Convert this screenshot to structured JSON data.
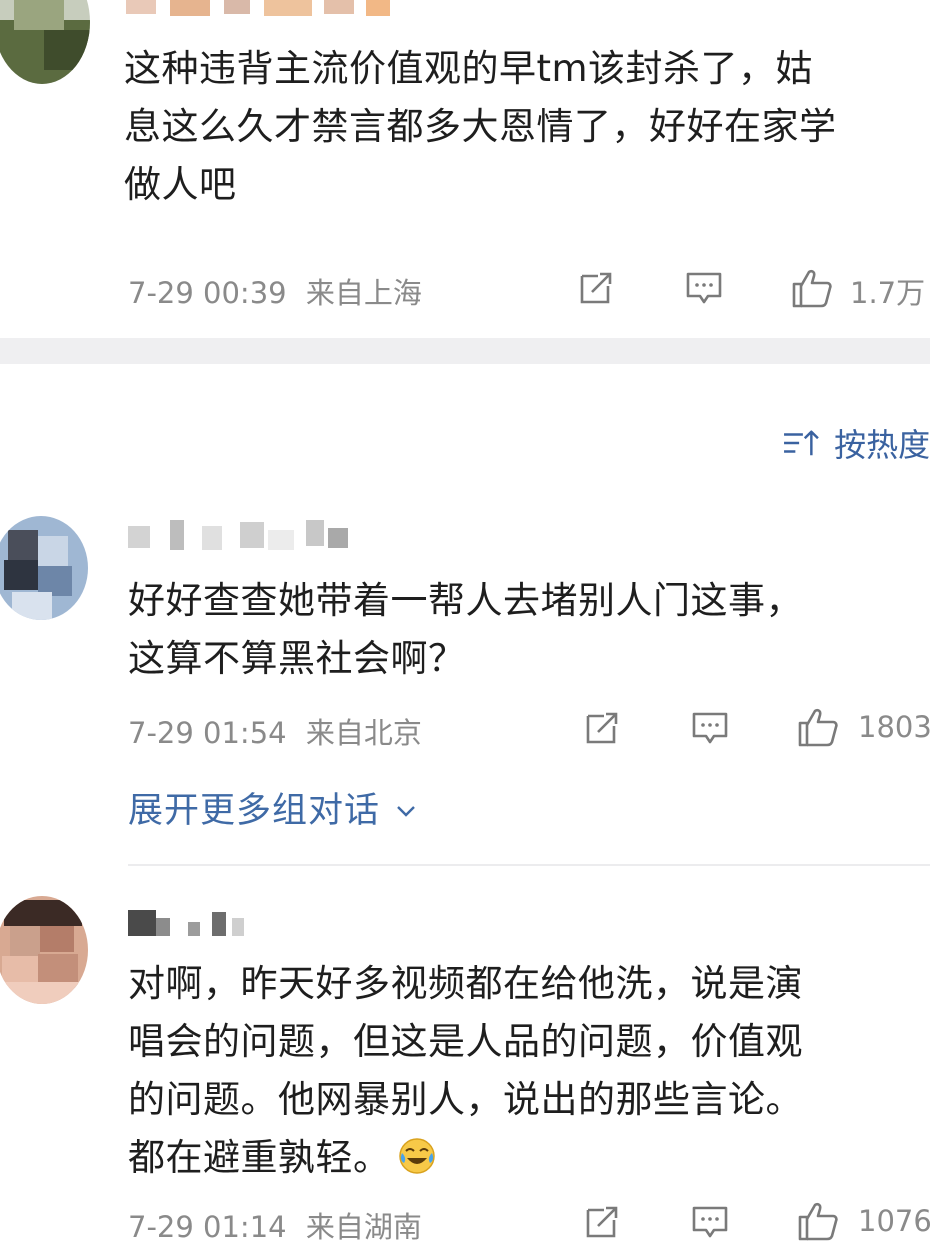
{
  "comments": [
    {
      "text": "这种违背主流价值观的早tm该封杀了，姑\n息这么久才禁言都多大恩情了，好好在家学\n做人吧",
      "time": "7-29 00:39",
      "location": "来自上海",
      "likes": "1.7万"
    },
    {
      "text": "好好查查她带着一帮人去堵别人门这事，\n这算不算黑社会啊？",
      "time": "7-29 01:54",
      "location": "来自北京",
      "likes": "1803"
    },
    {
      "text": "对啊，昨天好多视频都在给他洗，说是演\n唱会的问题，但这是人品的问题，价值观\n的问题。他网暴别人，说出的那些言论。\n都在避重孰轻。",
      "time": "7-29 01:14",
      "location": "来自湖南",
      "likes": "1076"
    }
  ],
  "sort": {
    "label": "按热度"
  },
  "expand": {
    "label": "展开更多组对话"
  },
  "colors": {
    "link": "#3f6aa6",
    "meta": "#8a8a8a",
    "band": "#efeff1"
  },
  "icons": {
    "share": "share-icon",
    "comment": "comment-icon",
    "like": "thumbs-up-icon",
    "sort": "sort-icon",
    "chevron": "chevron-down-icon",
    "emoji": "laughing-crying-emoji-icon"
  }
}
